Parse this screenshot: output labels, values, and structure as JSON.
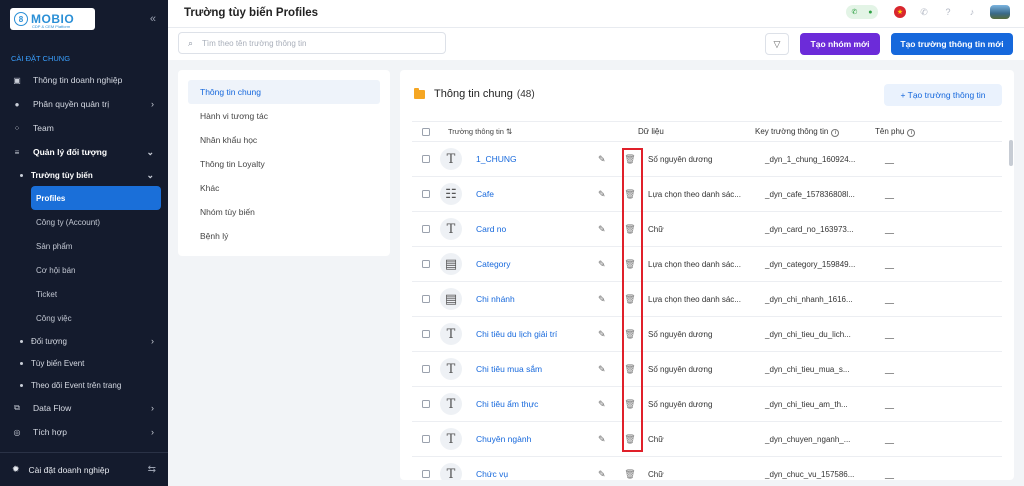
{
  "sidebar": {
    "logo_text": "MOBIO",
    "logo_sub": "CDP & CEM Platform",
    "collapse_icon": "double-chevron-left-icon",
    "section_title": "CÀI ĐẶT CHUNG",
    "items": [
      {
        "label": "Thông tin doanh nghiệp",
        "icon": "building-icon"
      },
      {
        "label": "Phân quyền quản trị",
        "icon": "user-shield-icon"
      },
      {
        "label": "Team",
        "icon": "team-icon"
      },
      {
        "label": "Quản lý đối tượng",
        "icon": "database-icon"
      }
    ],
    "sub_custom_fields": "Trường tùy biến",
    "leaves": [
      "Profiles",
      "Công ty (Account)",
      "Sản phẩm",
      "Cơ hội bán",
      "Ticket",
      "Công việc"
    ],
    "subs_after": [
      "Đối tượng",
      "Tùy biến Event",
      "Theo dõi Event trên trang"
    ],
    "items_after": [
      {
        "label": "Data Flow",
        "icon": "data-flow-icon"
      },
      {
        "label": "Tích hợp",
        "icon": "integration-icon"
      }
    ],
    "footer_label": "Cài đặt doanh nghiệp"
  },
  "topbar": {
    "title": "Trường tùy biến Profiles"
  },
  "toolbar": {
    "search_placeholder": "Tìm theo tên trường thông tin",
    "create_group": "Tạo nhóm mới",
    "create_field": "Tạo trường thông tin mới"
  },
  "groups": [
    "Thông tin chung",
    "Hành vi tương tác",
    "Nhân khẩu học",
    "Thông tin Loyalty",
    "Khác",
    "Nhóm tùy biến",
    "Bệnh lý"
  ],
  "panel": {
    "title": "Thông tin chung",
    "count": "(48)",
    "add_button": "+ Tạo trường thông tin"
  },
  "table": {
    "headers": {
      "field": "Trường thông tin",
      "data": "Dữ liệu",
      "key": "Key trường thông tin",
      "sub": "Tên phụ"
    },
    "rows": [
      {
        "name": "1_CHUNG",
        "type": "text",
        "data": "Số nguyên dương",
        "key": "_dyn_1_chung_160924...",
        "sub": "__"
      },
      {
        "name": "Cafe",
        "type": "select",
        "data": "Lựa chọn theo danh sác...",
        "key": "_dyn_cafe_157836808l...",
        "sub": "__"
      },
      {
        "name": "Card no",
        "type": "text",
        "data": "Chữ",
        "key": "_dyn_card_no_163973...",
        "sub": "__"
      },
      {
        "name": "Category",
        "type": "dropdown",
        "data": "Lựa chọn theo danh sác...",
        "key": "_dyn_category_159849...",
        "sub": "__"
      },
      {
        "name": "Chi nhánh",
        "type": "dropdown",
        "data": "Lựa chọn theo danh sác...",
        "key": "_dyn_chi_nhanh_1616...",
        "sub": "__"
      },
      {
        "name": "Chi tiêu du lịch giải trí",
        "type": "text",
        "data": "Số nguyên dương",
        "key": "_dyn_chi_tieu_du_lich...",
        "sub": "__"
      },
      {
        "name": "Chi tiêu mua sắm",
        "type": "text",
        "data": "Số nguyên dương",
        "key": "_dyn_chi_tieu_mua_s...",
        "sub": "__"
      },
      {
        "name": "Chi tiêu ẩm thực",
        "type": "text",
        "data": "Số nguyên dương",
        "key": "_dyn_chi_tieu_am_th...",
        "sub": "__"
      },
      {
        "name": "Chuyên ngành",
        "type": "text",
        "data": "Chữ",
        "key": "_dyn_chuyen_nganh_...",
        "sub": "__"
      },
      {
        "name": "Chức vụ",
        "type": "text",
        "data": "Chữ",
        "key": "_dyn_chuc_vu_157586...",
        "sub": "__"
      }
    ]
  }
}
